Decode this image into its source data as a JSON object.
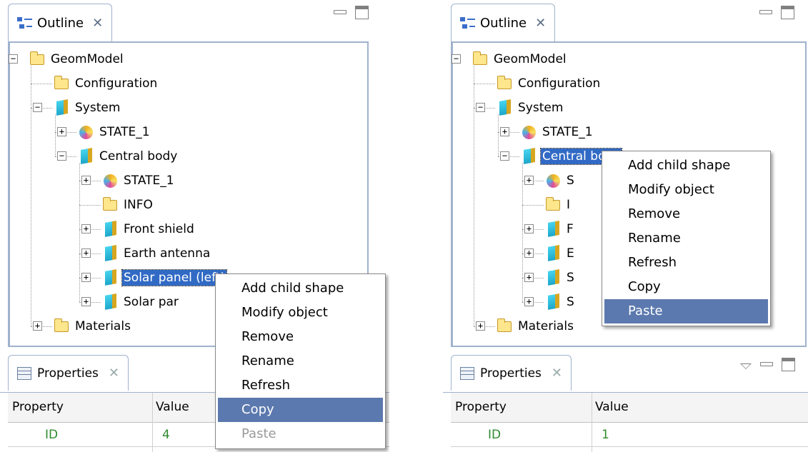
{
  "left": {
    "outline": {
      "title": "Outline",
      "close": "✕"
    },
    "tree": [
      {
        "label": "GeomModel",
        "icon": "folder-icon",
        "expander": "−"
      },
      {
        "label": "Configuration",
        "icon": "folder-icon",
        "expander": ""
      },
      {
        "label": "System",
        "icon": "shape-icon",
        "expander": "−"
      },
      {
        "label": "STATE_1",
        "icon": "state-icon",
        "expander": "+"
      },
      {
        "label": "Central body",
        "icon": "shape-icon",
        "expander": "−"
      },
      {
        "label": "STATE_1",
        "icon": "state-icon",
        "expander": "+"
      },
      {
        "label": "INFO",
        "icon": "folder-icon",
        "expander": ""
      },
      {
        "label": "Front shield",
        "icon": "shape-icon",
        "expander": "+"
      },
      {
        "label": "Earth antenna",
        "icon": "shape-icon",
        "expander": "+"
      },
      {
        "label": "Solar panel (left)",
        "icon": "shape-icon",
        "expander": "+",
        "selected": true
      },
      {
        "label": "Solar par",
        "icon": "shape-icon",
        "expander": "+"
      },
      {
        "label": "Materials",
        "icon": "folder-icon",
        "expander": "+"
      }
    ],
    "menu": [
      {
        "label": "Add child shape"
      },
      {
        "label": "Modify object"
      },
      {
        "label": "Remove"
      },
      {
        "label": "Rename"
      },
      {
        "label": "Refresh"
      },
      {
        "label": "Copy",
        "highlight": true
      },
      {
        "label": "Paste",
        "disabled": true
      }
    ],
    "properties": {
      "title": "Properties",
      "close": "✕",
      "col1": "Property",
      "col2": "Value",
      "row_key": "ID",
      "row_value": "4"
    }
  },
  "right": {
    "outline": {
      "title": "Outline",
      "close": "✕"
    },
    "tree": [
      {
        "label": "GeomModel",
        "icon": "folder-icon",
        "expander": "−"
      },
      {
        "label": "Configuration",
        "icon": "folder-icon",
        "expander": ""
      },
      {
        "label": "System",
        "icon": "shape-icon",
        "expander": "−"
      },
      {
        "label": "STATE_1",
        "icon": "state-icon",
        "expander": "+"
      },
      {
        "label": "Central body",
        "icon": "shape-icon",
        "expander": "−",
        "selected": true
      },
      {
        "label": "S",
        "icon": "state-icon",
        "expander": "+"
      },
      {
        "label": "I",
        "icon": "folder-icon",
        "expander": ""
      },
      {
        "label": "F",
        "icon": "shape-icon",
        "expander": "+"
      },
      {
        "label": "E",
        "icon": "shape-icon",
        "expander": "+"
      },
      {
        "label": "S",
        "icon": "shape-icon",
        "expander": "+"
      },
      {
        "label": "S",
        "icon": "shape-icon",
        "expander": "+"
      },
      {
        "label": "Materials",
        "icon": "folder-icon",
        "expander": "+"
      }
    ],
    "menu": [
      {
        "label": "Add child shape"
      },
      {
        "label": "Modify object"
      },
      {
        "label": "Remove"
      },
      {
        "label": "Rename"
      },
      {
        "label": "Refresh"
      },
      {
        "label": "Copy"
      },
      {
        "label": "Paste",
        "highlight": true
      }
    ],
    "properties": {
      "title": "Properties",
      "close": "✕",
      "col1": "Property",
      "col2": "Value",
      "row_key": "ID",
      "row_value": "1"
    }
  },
  "colors": {
    "selection": "#316ac5",
    "menu_highlight": "#5b79ae",
    "border": "#9fb2cc",
    "property_text": "#2e8b2e"
  }
}
